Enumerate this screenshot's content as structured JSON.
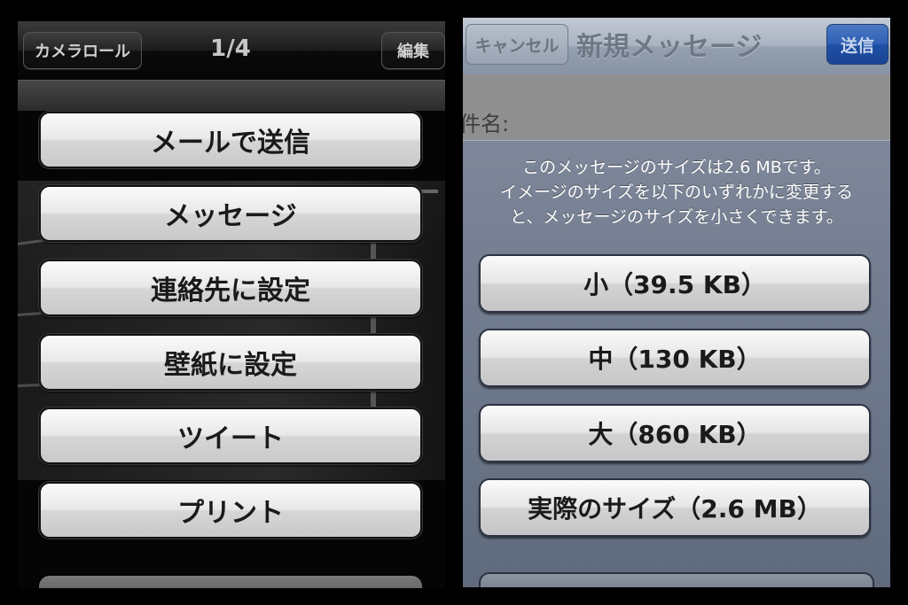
{
  "left": {
    "toolbar": {
      "camera_roll_label": "カメラロール",
      "counter": "1/4",
      "edit_label": "編集"
    },
    "action_sheet": [
      {
        "label": "メールで送信"
      },
      {
        "label": "メッセージ"
      },
      {
        "label": "連絡先に設定"
      },
      {
        "label": "壁紙に設定"
      },
      {
        "label": "ツイート"
      },
      {
        "label": "プリント"
      }
    ]
  },
  "right": {
    "navbar": {
      "cancel_label": "キャンセル",
      "title": "新規メッセージ",
      "send_label": "送信"
    },
    "compose": {
      "subject_label": "件名:"
    },
    "size_sheet": {
      "message_line1": "このメッセージのサイズは2.6 MBです。",
      "message_line2": "イメージのサイズを以下のいずれかに変更する",
      "message_line3": "と、メッセージのサイズを小さくできます。",
      "options": [
        {
          "label": "小（39.5 KB）"
        },
        {
          "label": "中（130 KB）"
        },
        {
          "label": "大（860 KB）"
        },
        {
          "label": "実際のサイズ（2.6 MB）"
        }
      ]
    }
  },
  "colors": {
    "send_button": "#2f5fb4",
    "navbar": "#a8b2c0",
    "sheet_button": "#e8e8e8"
  }
}
